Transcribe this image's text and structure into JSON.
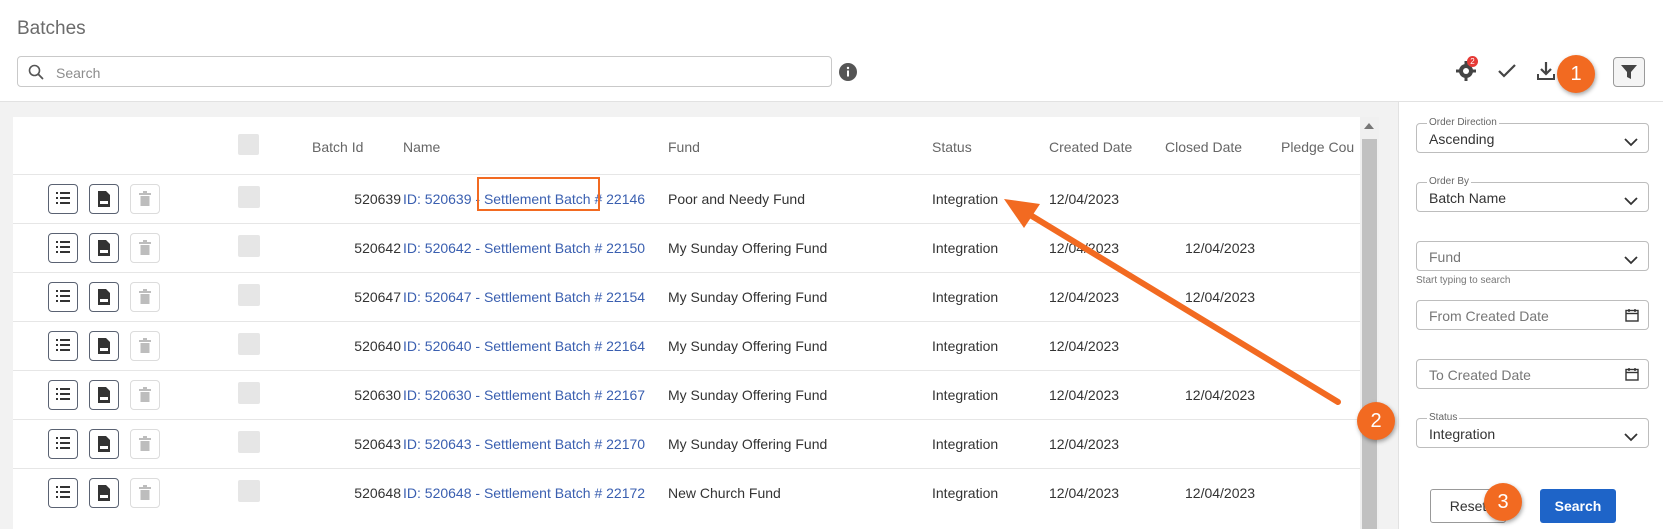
{
  "page": {
    "title": "Batches"
  },
  "search": {
    "placeholder": "Search"
  },
  "table": {
    "headers": {
      "batch_id": "Batch Id",
      "name": "Name",
      "fund": "Fund",
      "status": "Status",
      "created": "Created Date",
      "closed": "Closed Date",
      "pledge": "Pledge Cou"
    },
    "rows": [
      {
        "batch_id": "520639",
        "name": "ID: 520639 - Settlement Batch # 22146",
        "fund": "Poor and Needy Fund",
        "status": "Integration",
        "created": "12/04/2023",
        "closed": ""
      },
      {
        "batch_id": "520642",
        "name": "ID: 520642 - Settlement Batch # 22150",
        "fund": "My Sunday Offering Fund",
        "status": "Integration",
        "created": "12/04/2023",
        "closed": "12/04/2023"
      },
      {
        "batch_id": "520647",
        "name": "ID: 520647 - Settlement Batch # 22154",
        "fund": "My Sunday Offering Fund",
        "status": "Integration",
        "created": "12/04/2023",
        "closed": "12/04/2023"
      },
      {
        "batch_id": "520640",
        "name": "ID: 520640 - Settlement Batch # 22164",
        "fund": "My Sunday Offering Fund",
        "status": "Integration",
        "created": "12/04/2023",
        "closed": ""
      },
      {
        "batch_id": "520630",
        "name": "ID: 520630 - Settlement Batch # 22167",
        "fund": "My Sunday Offering Fund",
        "status": "Integration",
        "created": "12/04/2023",
        "closed": "12/04/2023"
      },
      {
        "batch_id": "520643",
        "name": "ID: 520643 - Settlement Batch # 22170",
        "fund": "My Sunday Offering Fund",
        "status": "Integration",
        "created": "12/04/2023",
        "closed": ""
      },
      {
        "batch_id": "520648",
        "name": "ID: 520648 - Settlement Batch # 22172",
        "fund": "New Church Fund",
        "status": "Integration",
        "created": "12/04/2023",
        "closed": "12/04/2023"
      }
    ]
  },
  "toolbar": {
    "badge_count": "2"
  },
  "filters": {
    "order_direction": {
      "label": "Order Direction",
      "value": "Ascending"
    },
    "order_by": {
      "label": "Order By",
      "value": "Batch Name"
    },
    "fund": {
      "placeholder": "Fund",
      "hint": "Start typing to search"
    },
    "from_date": {
      "placeholder": "From Created Date"
    },
    "to_date": {
      "placeholder": "To Created Date"
    },
    "status": {
      "label": "Status",
      "value": "Integration"
    },
    "reset_label": "Reset",
    "search_label": "Search"
  },
  "callouts": {
    "one": "1",
    "two": "2",
    "three": "3"
  },
  "colors": {
    "accent": "#f26a21",
    "primary": "#1e64c8",
    "link": "#3a5fb0"
  }
}
